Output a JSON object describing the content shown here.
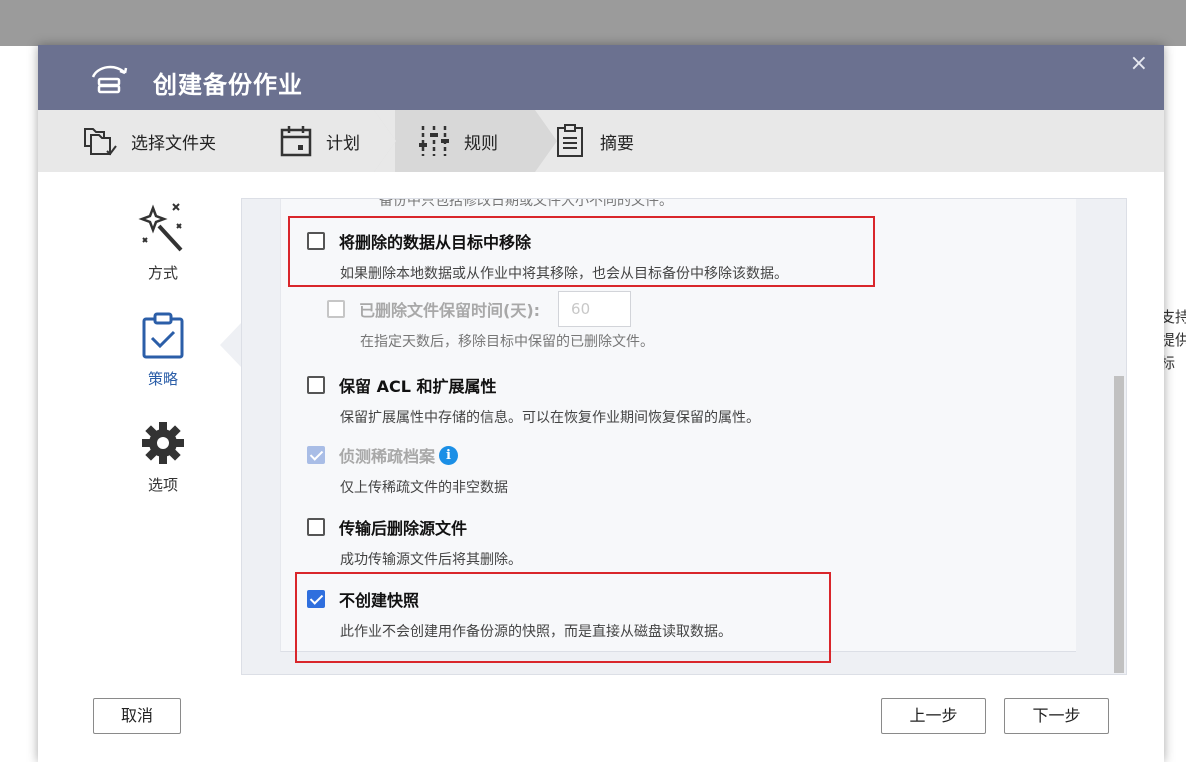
{
  "background": {
    "side_text": [
      "支持",
      "提供",
      "标"
    ]
  },
  "dialog": {
    "title": "创建备份作业",
    "close": "×",
    "steps": [
      {
        "label": "选择文件夹",
        "icon": "folder-copy-icon"
      },
      {
        "label": "计划",
        "icon": "calendar-icon"
      },
      {
        "label": "规则",
        "icon": "sliders-icon"
      },
      {
        "label": "摘要",
        "icon": "clipboard-icon"
      }
    ],
    "active_step": "规则",
    "leftnav": [
      {
        "label": "方式",
        "icon": "magic-wand-icon"
      },
      {
        "label": "策略",
        "icon": "clipboard-check-icon"
      },
      {
        "label": "选项",
        "icon": "gear-icon"
      }
    ],
    "active_nav": "策略",
    "options": {
      "cut_top_text": "备份中只包括修改日期或文件大小不同的文件。",
      "remove_deleted": {
        "title": "将删除的数据从目标中移除",
        "desc": "如果删除本地数据或从作业中将其移除，也会从目标备份中移除该数据。",
        "checked": false
      },
      "retention": {
        "title": "已删除文件保留时间(天):",
        "value": "60",
        "desc": "在指定天数后，移除目标中保留的已删除文件。",
        "checked": false,
        "disabled": true
      },
      "keep_acl": {
        "title": "保留 ACL 和扩展属性",
        "desc": "保留扩展属性中存储的信息。可以在恢复作业期间恢复保留的属性。",
        "checked": false
      },
      "sparse": {
        "title": "侦测稀疏档案",
        "desc": "仅上传稀疏文件的非空数据",
        "checked": true,
        "disabled": true
      },
      "delete_source": {
        "title": "传输后删除源文件",
        "desc": "成功传输源文件后将其删除。",
        "checked": false
      },
      "no_snapshot": {
        "title": "不创建快照",
        "desc": "此作业不会创建用作备份源的快照，而是直接从磁盘读取数据。",
        "checked": true
      }
    },
    "footer": {
      "cancel": "取消",
      "prev": "上一步",
      "next": "下一步"
    }
  },
  "colors": {
    "title_bar": "#6b7190",
    "checkbox_checked": "#2f6fde",
    "highlight_box": "#d9262b",
    "info_icon": "#1b8fe6"
  }
}
